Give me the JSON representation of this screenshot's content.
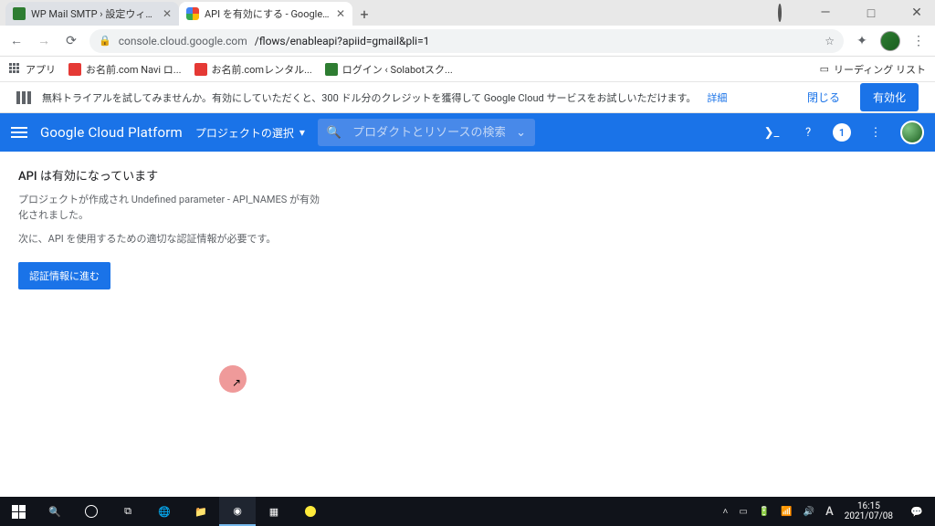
{
  "browser": {
    "tabs": [
      {
        "title": "WP Mail SMTP › 設定ウィザード",
        "favicon": "green",
        "active": false
      },
      {
        "title": "API を有効にする - Google Cloud",
        "favicon": "gcp",
        "active": true
      }
    ],
    "url_host": "console.cloud.google.com",
    "url_path": "/flows/enableapi?apiid=gmail&pli=1",
    "bookmarks_label": "アプリ",
    "bookmarks": [
      {
        "label": "お名前.com Navi ロ...",
        "icon": "onamae"
      },
      {
        "label": "お名前.comレンタル...",
        "icon": "onamae"
      },
      {
        "label": "ログイン ‹ Solabotスク...",
        "icon": "sola"
      }
    ],
    "reading_list": "リーディング リスト"
  },
  "trial_banner": {
    "text": "無料トライアルを試してみませんか。有効にしていただくと、300 ドル分のクレジットを獲得して Google Cloud サービスをお試しいただけます。",
    "link": "詳細",
    "close": "閉じる",
    "activate": "有効化"
  },
  "gcp_bar": {
    "logo": "Google Cloud Platform",
    "project_selector": "プロジェクトの選択",
    "search_placeholder": "プロダクトとリソースの検索",
    "notification_badge": "1"
  },
  "main": {
    "heading": "API は有効になっています",
    "line1": "プロジェクトが作成され Undefined parameter - API_NAMES が有効化されました。",
    "line2": "次に、API を使用するための適切な認証情報が必要です。",
    "button": "認証情報に進む"
  },
  "taskbar": {
    "time": "16:15",
    "date": "2021/07/08",
    "ime": "A"
  }
}
